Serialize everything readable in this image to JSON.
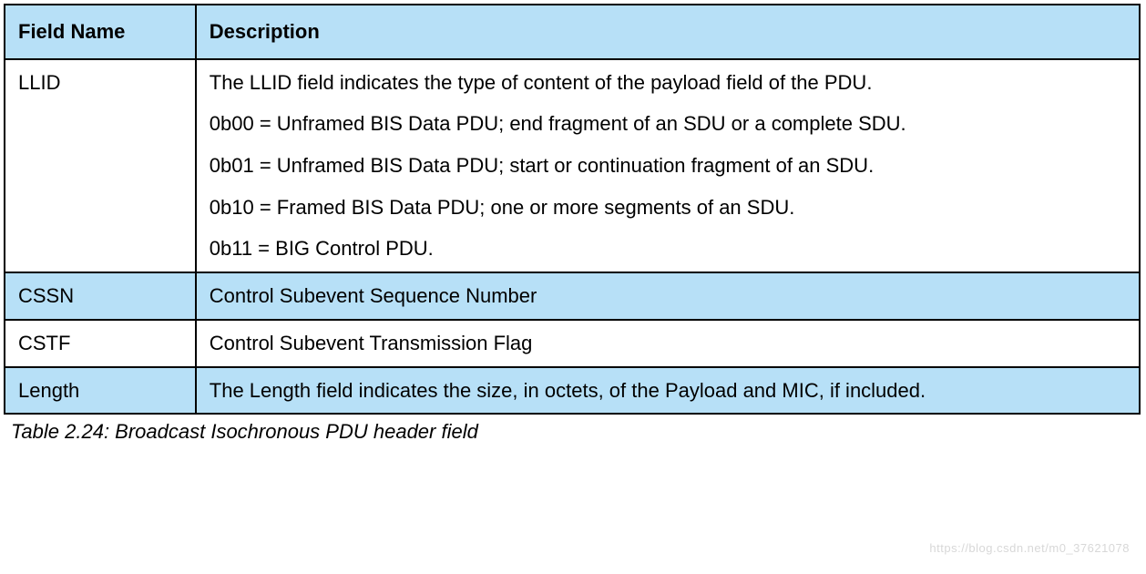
{
  "table": {
    "headers": {
      "field": "Field Name",
      "description": "Description"
    },
    "rows": [
      {
        "field": "LLID",
        "alt": false,
        "description_lines": [
          "The LLID field indicates the type of content of the payload field of the PDU.",
          "0b00 = Unframed BIS Data PDU; end fragment of an SDU or a complete SDU.",
          "0b01 = Unframed BIS Data PDU; start or continuation fragment of an SDU.",
          "0b10 = Framed BIS Data PDU; one or more segments of an SDU.",
          "0b11 = BIG Control PDU."
        ]
      },
      {
        "field": "CSSN",
        "alt": true,
        "description_lines": [
          "Control Subevent Sequence Number"
        ]
      },
      {
        "field": "CSTF",
        "alt": false,
        "description_lines": [
          "Control Subevent Transmission Flag"
        ]
      },
      {
        "field": "Length",
        "alt": true,
        "description_lines": [
          "The Length field indicates the size, in octets, of the Payload and MIC, if included."
        ]
      }
    ]
  },
  "caption": "Table 2.24:  Broadcast Isochronous PDU header field",
  "watermark": "https://blog.csdn.net/m0_37621078"
}
